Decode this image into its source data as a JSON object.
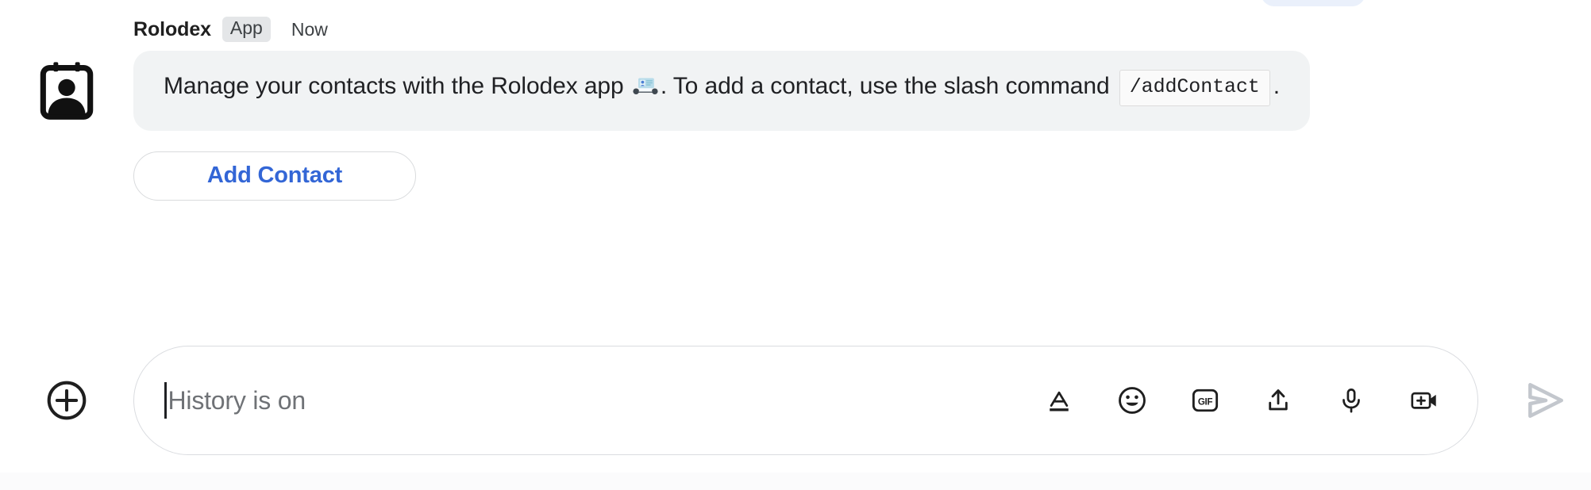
{
  "window": {
    "background_color": "#ffffff"
  },
  "scrolled_message_peek": {
    "name": "partially-visible-previous-message",
    "color": "#eaf0fb"
  },
  "message": {
    "avatar_icon": "contact-card-icon",
    "sender": "Rolodex",
    "badge": "App",
    "timestamp": "Now",
    "bubble": {
      "background_color": "#f1f3f4",
      "text_before_emoji": "Manage your contacts with the Rolodex app",
      "emoji": "card-index-emoji",
      "text_after_emoji": ". To add a contact, use the slash command",
      "code_chip": "/addContact",
      "text_end": "."
    },
    "actions": [
      {
        "label": "Add Contact",
        "name": "add-contact-button",
        "text_color": "#3366d6"
      }
    ]
  },
  "composer": {
    "attach_icon": "plus-circle-icon",
    "input": {
      "value": "",
      "placeholder": "History is on",
      "caret_visible": true
    },
    "tools": [
      {
        "name": "format-text-icon",
        "label": "A"
      },
      {
        "name": "emoji-icon",
        "label": ""
      },
      {
        "name": "gif-icon",
        "label": "GIF"
      },
      {
        "name": "upload-file-icon",
        "label": ""
      },
      {
        "name": "microphone-icon",
        "label": ""
      },
      {
        "name": "add-video-icon",
        "label": ""
      }
    ],
    "send": {
      "name": "send-button",
      "enabled": false,
      "color": "#c3c7cd"
    }
  }
}
